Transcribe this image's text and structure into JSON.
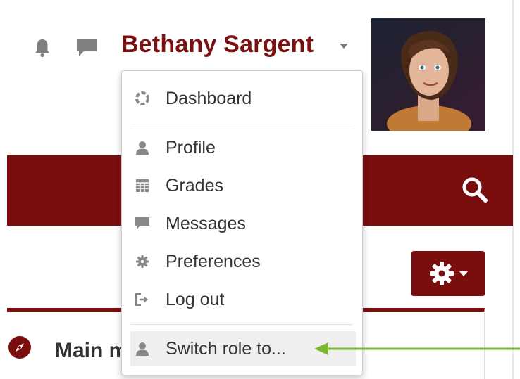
{
  "header": {
    "user_name": "Bethany Sargent",
    "notifications_icon": "bell-icon",
    "messages_icon": "chat-bubble-icon"
  },
  "user_menu": {
    "items": [
      {
        "label": "Dashboard",
        "icon": "dashboard-icon"
      },
      {
        "label": "Profile",
        "icon": "user-icon"
      },
      {
        "label": "Grades",
        "icon": "grid-table-icon"
      },
      {
        "label": "Messages",
        "icon": "chat-bubble-icon"
      },
      {
        "label": "Preferences",
        "icon": "gear-icon"
      },
      {
        "label": "Log out",
        "icon": "sign-out-icon"
      },
      {
        "label": "Switch role to...",
        "icon": "user-icon"
      }
    ]
  },
  "block": {
    "title": "Main menu"
  },
  "colors": {
    "brand": "#7a0d0d",
    "username": "#7a1010",
    "annotation_arrow": "#7cb82f",
    "menu_highlight": "#efefef"
  }
}
